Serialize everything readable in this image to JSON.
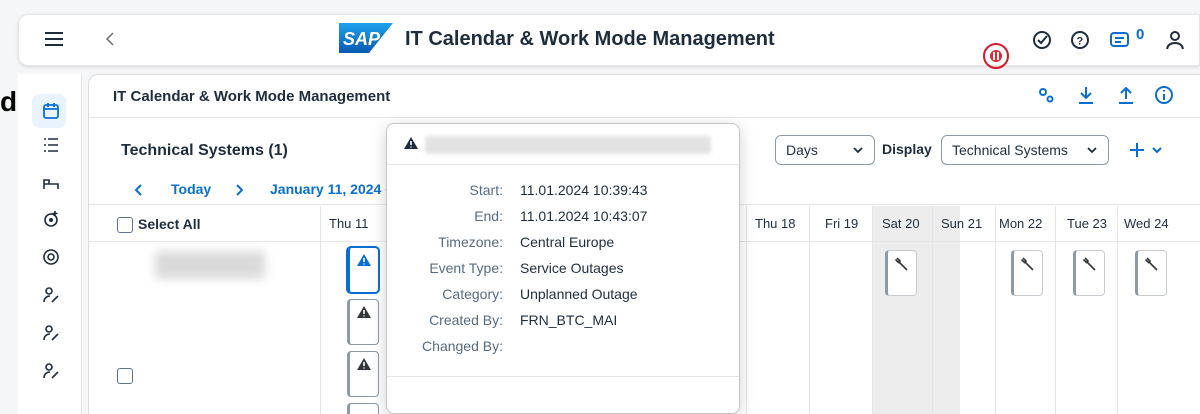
{
  "shell": {
    "logo_text": "SAP",
    "app_title": "IT Calendar & Work Mode Management",
    "notification_count": "0"
  },
  "edge_text": "d",
  "main": {
    "title": "IT Calendar & Work Mode Management",
    "table_title": "Technical Systems (1)",
    "view_select": "Days",
    "display_label": "Display",
    "display_select": "Technical Systems"
  },
  "nav": {
    "today": "Today",
    "date_range": "January 11, 2024 -"
  },
  "grid": {
    "select_all": "Select All",
    "days_visible": {
      "d1": "Thu 11",
      "d2": "Thu 18",
      "d3": "Fri 19",
      "d4": "Sat 20",
      "d5": "Sun 21",
      "d6": "Mon 22",
      "d7": "Tue 23",
      "d8": "Wed 24"
    }
  },
  "popover": {
    "rows": {
      "start": {
        "label": "Start:",
        "value": "11.01.2024 10:39:43"
      },
      "end": {
        "label": "End:",
        "value": "11.01.2024 10:43:07"
      },
      "timezone": {
        "label": "Timezone:",
        "value": "Central Europe"
      },
      "event_type": {
        "label": "Event Type:",
        "value": "Service Outages"
      },
      "category": {
        "label": "Category:",
        "value": "Unplanned Outage"
      },
      "created_by": {
        "label": "Created By:",
        "value": "FRN_BTC_MAI"
      },
      "changed_by": {
        "label": "Changed By:",
        "value": ""
      }
    }
  },
  "colors": {
    "accent": "#0a6ed1",
    "recording_red": "#e52733",
    "text": "#1d2d3e",
    "label": "#556b82",
    "weekend": "#ededed"
  },
  "icons": [
    "menu-icon",
    "back-icon",
    "record-icon",
    "activity-icon",
    "help-icon",
    "notification-icon",
    "user-icon",
    "calendar-icon",
    "list-icon",
    "workmode-icon",
    "settings-icon",
    "at-icon",
    "person-edit-icon",
    "gears-icon",
    "download-icon",
    "upload-icon",
    "info-icon",
    "warning-icon",
    "wrench-icon",
    "add-icon"
  ]
}
